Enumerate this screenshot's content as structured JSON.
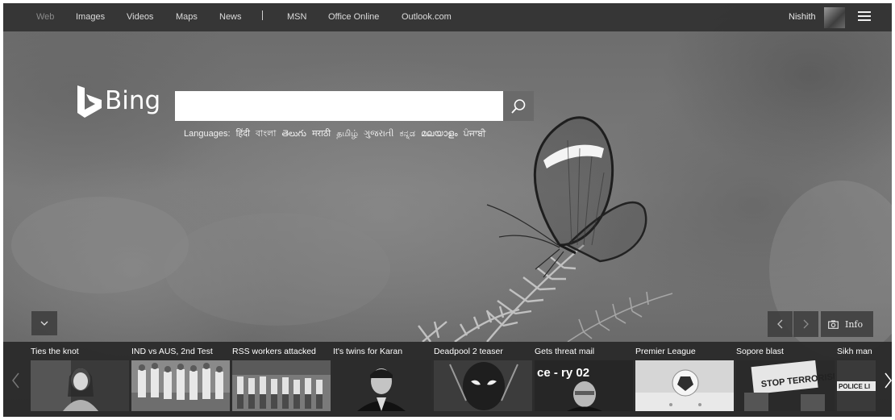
{
  "nav": {
    "items": [
      "Web",
      "Images",
      "Videos",
      "Maps",
      "News",
      "MSN",
      "Office Online",
      "Outlook.com"
    ],
    "active": "Web",
    "user_name": "Nishith"
  },
  "logo": {
    "text": "Bing"
  },
  "search": {
    "value": ""
  },
  "languages": {
    "label": "Languages:",
    "items": [
      "हिंदी",
      "বাংলা",
      "తెలుగు",
      "मराठी",
      "தமிழ்",
      "ગુજરાતી",
      "ಕನ್ನಡ",
      "മലയാളം",
      "ਪੰਜਾਬੀ"
    ]
  },
  "info": {
    "label": "Info"
  },
  "news": [
    {
      "title": "Ties the knot",
      "thumb": "woman-portrait"
    },
    {
      "title": "IND vs AUS, 2nd Test",
      "thumb": "cricket-team"
    },
    {
      "title": "RSS workers attacked",
      "thumb": "marching-workers"
    },
    {
      "title": "It's twins for Karan",
      "thumb": "karan-portrait"
    },
    {
      "title": "Deadpool 2 teaser",
      "thumb": "deadpool"
    },
    {
      "title": "Gets threat mail",
      "thumb": "official-portrait",
      "overlay": "ce - ry 02"
    },
    {
      "title": "Premier League",
      "thumb": "football"
    },
    {
      "title": "Sopore blast",
      "thumb": "stop-terrorism-sign",
      "overlay": "STOP TERRORISM"
    },
    {
      "title": "Sikh man",
      "thumb": "police-line",
      "overlay": "POLICE LI"
    }
  ]
}
